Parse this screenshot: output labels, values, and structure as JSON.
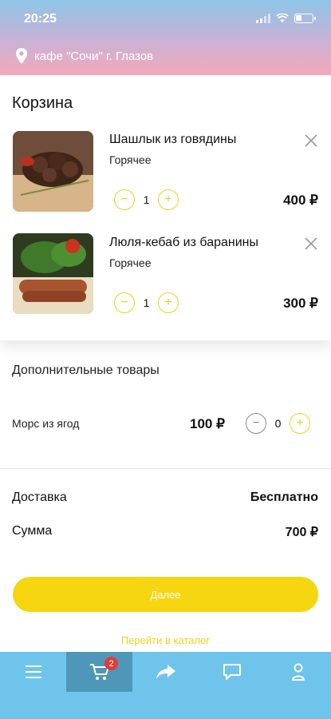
{
  "status_bar": {
    "time": "20:25"
  },
  "header": {
    "location": "кафе \"Сочи\" г. Глазов"
  },
  "cart": {
    "title": "Корзина",
    "items": [
      {
        "name": "Шашлык из говядины",
        "category": "Горячее",
        "qty": "1",
        "price": "400 ₽"
      },
      {
        "name": "Люля-кебаб из баранины",
        "category": "Горячее",
        "qty": "1",
        "price": "300 ₽"
      }
    ]
  },
  "extras": {
    "title": "Дополнительные товары",
    "items": [
      {
        "name": "Морс из ягод",
        "price": "100 ₽",
        "qty": "0"
      }
    ]
  },
  "summary": {
    "delivery_label": "Доставка",
    "delivery_value": "Бесплатно",
    "total_label": "Сумма",
    "total_value": "700 ₽"
  },
  "actions": {
    "next_label": "Далее",
    "catalog_link": "Перейти в каталог"
  },
  "tabbar": {
    "active": "cart",
    "cart_badge": "2",
    "items": [
      "menu-icon",
      "cart-icon",
      "share-icon",
      "chat-icon",
      "profile-icon"
    ]
  },
  "colors": {
    "accent_yellow": "#f6d511",
    "tabbar": "#6ec4ea",
    "tabbar_active": "#4f97b8",
    "badge": "#e23a3a"
  }
}
